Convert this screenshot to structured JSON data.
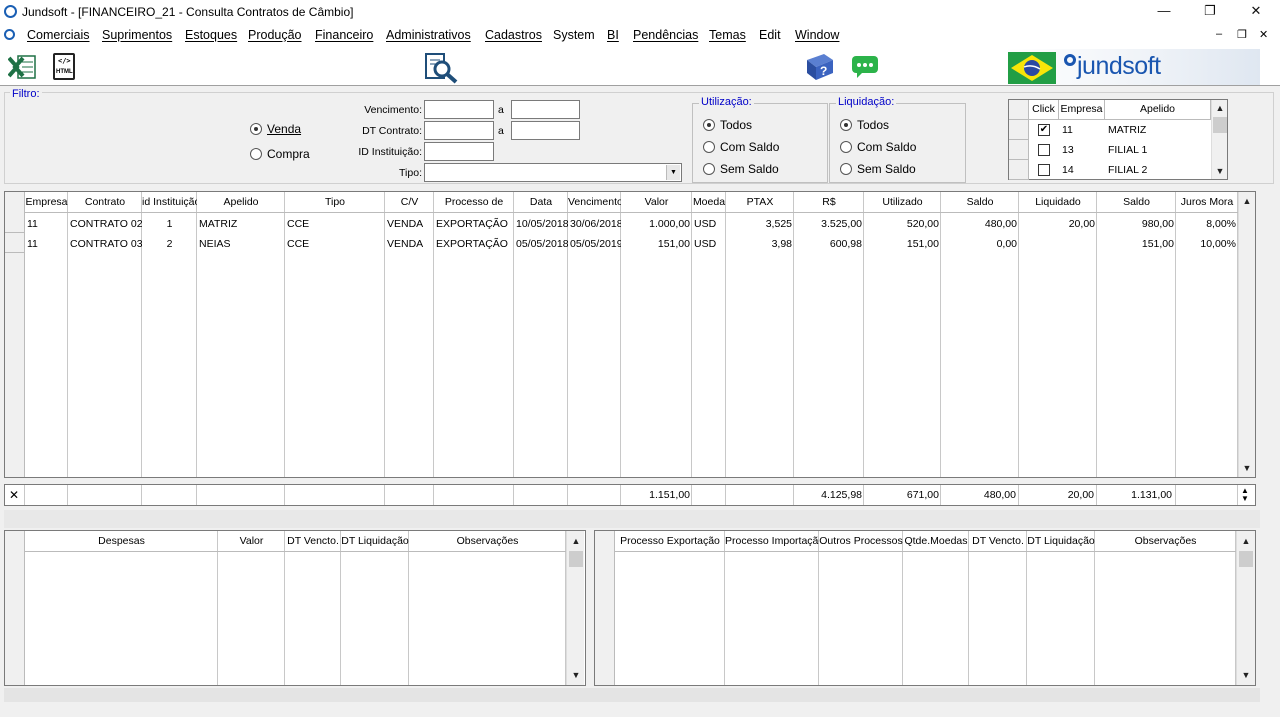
{
  "window": {
    "title": "Jundsoft - [FINANCEIRO_21 - Consulta Contratos de Câmbio]",
    "minimize": "—",
    "restore": "❐",
    "close": "✕"
  },
  "menu": [
    "Comerciais",
    "Suprimentos",
    "Estoques",
    "Produção",
    "Financeiro",
    "Administrativos",
    "Cadastros",
    "System",
    "BI",
    "Pendências",
    "Temas",
    "Edit",
    "Window"
  ],
  "mdi_controls": {
    "minimize": "–",
    "restore": "❐",
    "close": "✕"
  },
  "toolbar": {
    "excel_icon": "excel-export-icon",
    "html_icon": "html-export-icon",
    "html_text": "HTML",
    "search_icon": "document-search-icon",
    "help_icon": "help-book-icon",
    "chat_icon": "chat-icon",
    "brand": "jundsoft",
    "flag_icon": "brazil-flag-icon"
  },
  "filter": {
    "legend": "Filtro:",
    "direction": {
      "options": [
        "Venda",
        "Compra"
      ],
      "selected": "Venda"
    },
    "vencimento_label": "Vencimento:",
    "dt_contrato_label": "DT Contrato:",
    "id_instituicao_label": "ID Instituição:",
    "tipo_label": "Tipo:",
    "a_label": "a",
    "vencimento_from": "",
    "vencimento_to": "",
    "dt_contrato_from": "",
    "dt_contrato_to": "",
    "id_instituicao": "",
    "tipo": ""
  },
  "utilizacao": {
    "legend": "Utilização:",
    "options": [
      "Todos",
      "Com Saldo",
      "Sem Saldo"
    ],
    "selected": "Todos"
  },
  "liquidacao": {
    "legend": "Liquidação:",
    "options": [
      "Todos",
      "Com Saldo",
      "Sem Saldo"
    ],
    "selected": "Todos"
  },
  "empresas": {
    "headers": [
      "Click",
      "Empresa",
      "Apelido"
    ],
    "rows": [
      {
        "checked": true,
        "empresa": "11",
        "apelido": "MATRIZ"
      },
      {
        "checked": false,
        "empresa": "13",
        "apelido": "FILIAL 1"
      },
      {
        "checked": false,
        "empresa": "14",
        "apelido": "FILIAL 2"
      }
    ]
  },
  "main": {
    "headers": [
      "Empresa",
      "Contrato",
      "id Instituição",
      "Apelido",
      "Tipo",
      "C/V",
      "Processo de",
      "Data",
      "Vencimento",
      "Valor",
      "Moeda",
      "PTAX",
      "R$",
      "Utilizado",
      "Saldo",
      "Liquidado",
      "Saldo",
      "Juros Mora"
    ],
    "rows": [
      [
        "11",
        "CONTRATO 02",
        "1",
        "MATRIZ",
        "CCE",
        "VENDA",
        "EXPORTAÇÃO",
        "10/05/2018",
        "30/06/2018",
        "1.000,00",
        "USD",
        "3,525",
        "3.525,00",
        "520,00",
        "480,00",
        "20,00",
        "980,00",
        "8,00%"
      ],
      [
        "11",
        "CONTRATO 03",
        "2",
        "NEIAS",
        "CCE",
        "VENDA",
        "EXPORTAÇÃO",
        "05/05/2018",
        "05/05/2019",
        "151,00",
        "USD",
        "3,98",
        "600,98",
        "151,00",
        "0,00",
        "",
        "151,00",
        "10,00%"
      ]
    ],
    "totals": {
      "valor": "1.151,00",
      "rs": "4.125,98",
      "utilizado": "671,00",
      "saldo": "480,00",
      "liquidado": "20,00",
      "saldo2": "1.131,00"
    }
  },
  "despesas": {
    "headers": [
      "Despesas",
      "Valor",
      "DT Vencto.",
      "DT Liquidação",
      "Observações"
    ]
  },
  "processos": {
    "headers": [
      "Processo Exportação",
      "Processo Importação",
      "Outros Processos",
      "Qtde.Moedas",
      "DT Vencto.",
      "DT Liquidação",
      "Observações"
    ]
  }
}
